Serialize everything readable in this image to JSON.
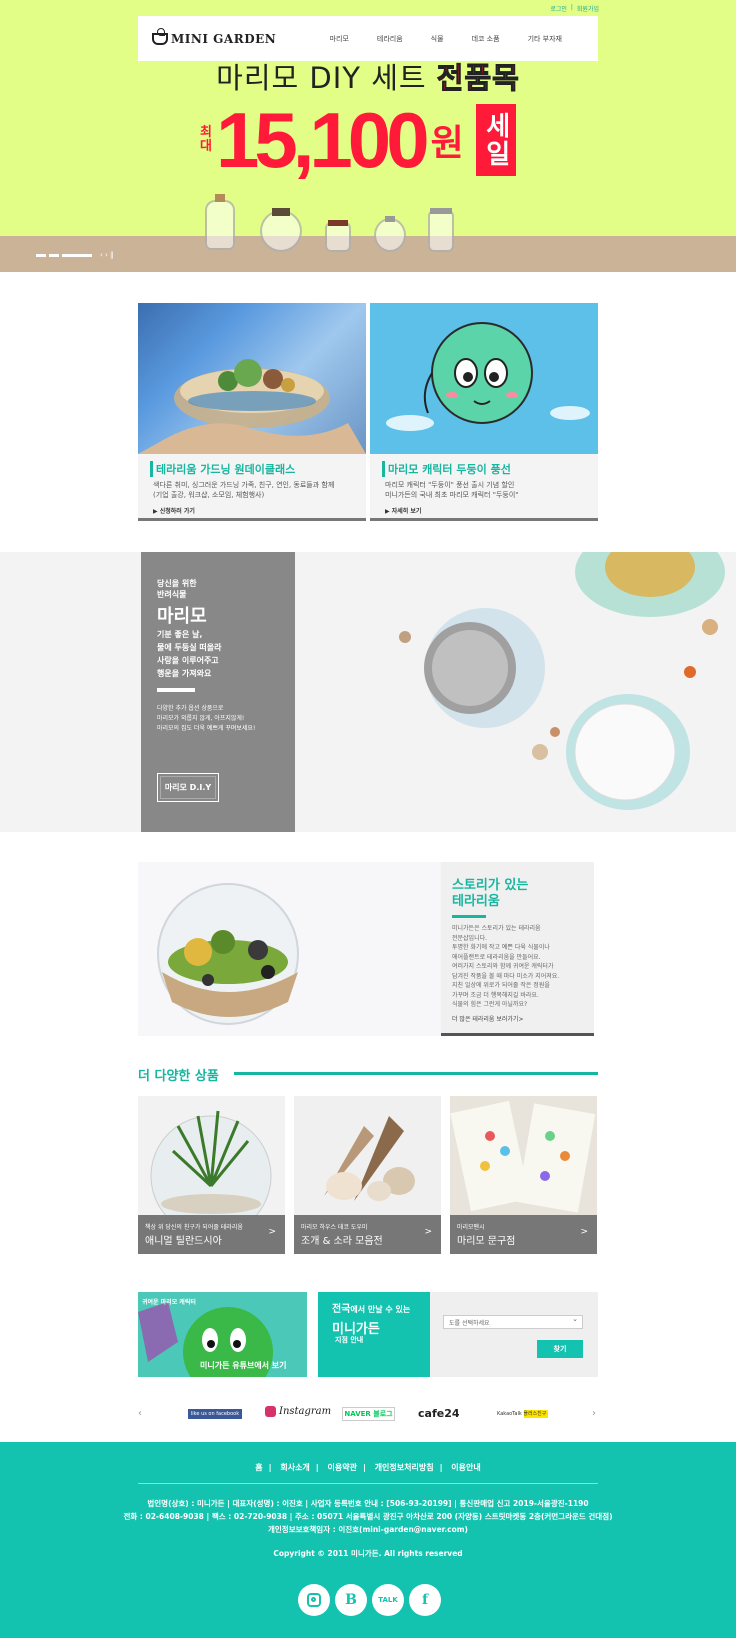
{
  "top_links": {
    "login": "로그인",
    "sep": "|",
    "join": "회원가입"
  },
  "header": {
    "logo": "MINI GARDEN",
    "nav": [
      "마리모",
      "테라리움",
      "식물",
      "데코 소품",
      "기타 부자재"
    ]
  },
  "hero": {
    "title_plain": "마리모 DIY 세트",
    "title_highlight": "전품목",
    "price_prefix": "최대",
    "price": "15,100",
    "price_unit": "원",
    "sale": "세일",
    "slider_ctrl": "‹ › ‖"
  },
  "cards": [
    {
      "title": "테라리움 가드닝 원데이클래스",
      "desc_1": "색다른 취미, 싱그러운 가드닝 가족, 친구, 연인, 동료들과 함께",
      "desc_2": "(기업 출강, 워크샵, 소모임, 체험행사)",
      "more": "▶ 신청하러 가기"
    },
    {
      "title": "마리모 캐릭터 두둥이 풍선",
      "desc_1": "마리모 캐릭터 \"두둥이\" 풍선 출시 기념 할인",
      "desc_2": "미니가든의 국내 최초 마리모 캐릭터 \"두둥이\"",
      "more": "▶ 자세히 보기"
    }
  ],
  "marimo_banner": {
    "sub_1": "당신을 위한",
    "sub_2": "반려식물",
    "title": "마리모",
    "line_1": "기분 좋은 날,",
    "line_2": "물에 두둥실 떠올라",
    "line_3": "사랑을 이루어주고",
    "line_4": "행운을 가져와요",
    "small_1": "다양한 추가 옵션 상품으로",
    "small_2": "마리모가 외롭지 않게, 아프지않게!",
    "small_3": "마리모의 집도 더욱 예쁘게 꾸며보세요!",
    "button": "마리모 D.I.Y"
  },
  "story": {
    "title_1": "스토리가 있는",
    "title_2": "테라리움",
    "text": [
      "미니가든은 스토리가 있는 테라리움",
      "전문샵입니다.",
      "투명한 화기에 작고 예쁜 다육 식물이나",
      "에어플랜트로 테라리움을 만들어요.",
      "여러가지 스토리와 함께 귀여운 캐릭터가",
      "담겨진 작품을 볼 때 마다 미소가 지어져요.",
      "지친 일상에 위로가 되어줄 작은 정원을",
      "가꾸며 조금 더 행복해지길 바라요.",
      "식물의 힘은 그런게 아닐까요?"
    ],
    "more": "더 많은 테라리움 보러가기>"
  },
  "more_products": {
    "title": "더 다양한 상품",
    "items": [
      {
        "sub": "책상 위 당신의 친구가 되어줄 테라리움",
        "name": "애니멀 틸란드시아",
        "arrow": ">"
      },
      {
        "sub": "마리모 하우스 데코 도우미",
        "name": "조개 & 소라 모음전",
        "arrow": ">"
      },
      {
        "sub": "마리모팬시",
        "name": "마리모 문구점",
        "arrow": ">"
      }
    ]
  },
  "banner_left": {
    "top": "귀여운 마리모 캐릭터",
    "bottom": "미니가든 유튜브에서 보기"
  },
  "store_finder": {
    "line_1_bold": "전국",
    "line_1_rest": "에서 만날 수 있는",
    "line_2": "미니가든",
    "line_3": "지점 안내",
    "select_placeholder": "도를 선택하세요",
    "button": "찾기"
  },
  "partners": {
    "prev": "‹",
    "next": "›",
    "items": [
      "like us on facebook",
      "Instagram",
      "NAVER 블로그",
      "cafe24",
      "KakaoTalk 플러스친구"
    ]
  },
  "footer": {
    "nav": [
      "홈",
      "회사소개",
      "이용약관",
      "개인정보처리방침",
      "이용안내"
    ],
    "info_1": "법인명(상호) : 미니가든 | 대표자(성명) : 이진호 | 사업자 등록번호 안내 : [506-93-20199] | 통신판매업 신고 2019-서울광진-1190",
    "info_2": "전화 : 02-6408-9038 | 팩스 : 02-720-9038 | 주소 : 05071 서울특별시 광진구 아차산로 200 (자양동) 스트릿마켓동 2층(커먼그라운드 건대점)",
    "info_3": "개인정보보호책임자 : 이진호(mini-garden@naver.com)",
    "copyright": "Copyright © 2011 미니가든. All rights reserved",
    "social": [
      "instagram-icon",
      "blog-icon",
      "kakaotalk-icon",
      "facebook-icon"
    ]
  },
  "colors": {
    "accent": "#13c3b0",
    "hero_bg": "#e2fe86",
    "sale_red": "#ff1a3a"
  }
}
